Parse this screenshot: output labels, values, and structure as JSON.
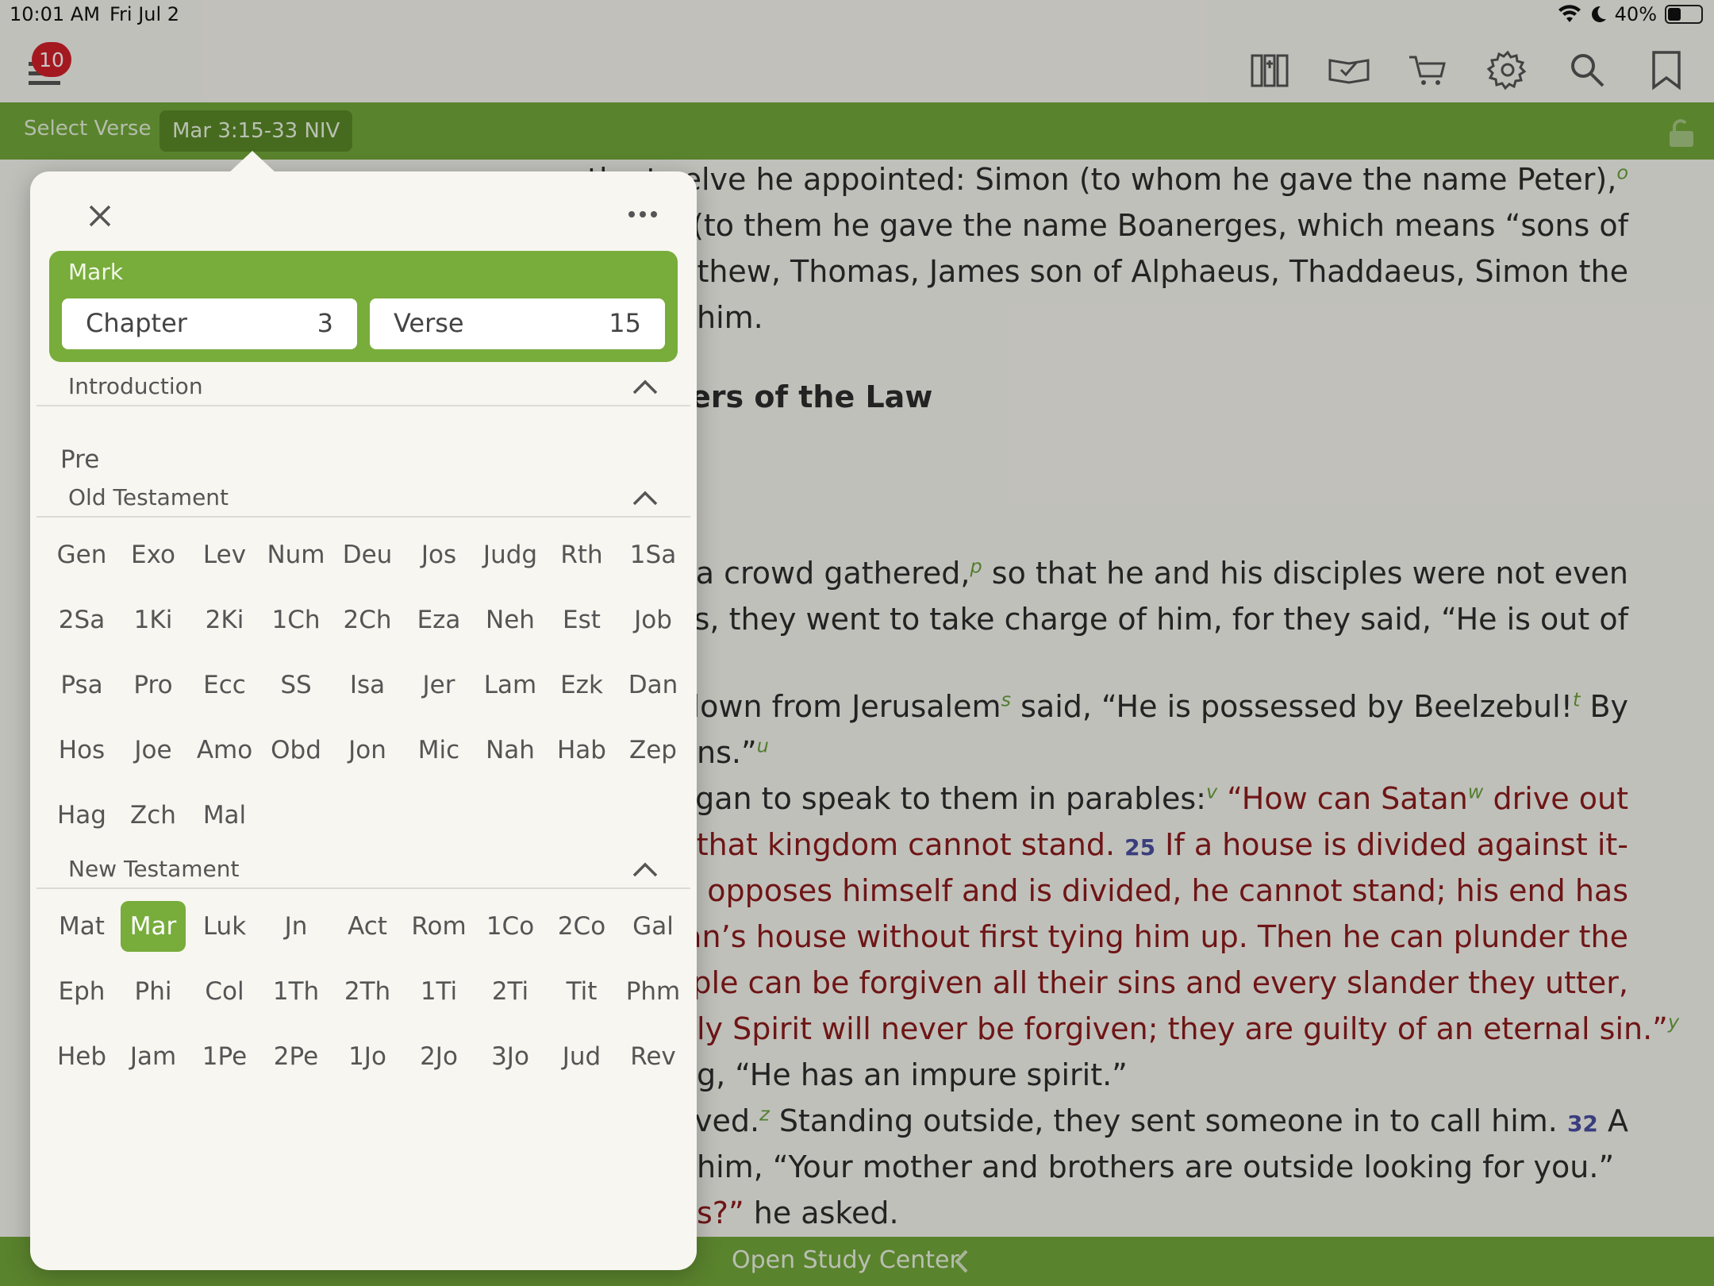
{
  "status": {
    "time": "10:01 AM",
    "date": "Fri Jul 2",
    "battery": "40%",
    "battery_level": 0.4
  },
  "toolbar": {
    "badge": "10"
  },
  "selectbar": {
    "label": "Select Verse",
    "reference": "Mar 3:15-33 NIV"
  },
  "reader": {
    "lines": [
      {
        "segments": [
          {
            "t": "the twelve he appointed: Simon (to whom he gave the name Peter),"
          },
          {
            "t": "o",
            "fn": true
          }
        ]
      },
      {
        "segments": [
          {
            "t": "John (to them he gave the name Boanerges, which means “sons of"
          }
        ]
      },
      {
        "segments": [
          {
            "t": ", Matthew, Thomas, James son of Alphaeus, Thaddaeus, Simon the"
          }
        ]
      },
      {
        "segments": [
          {
            "t": "him."
          }
        ],
        "left": true
      },
      {
        "segments": [
          {
            "t": "ers of the Law",
            "heading": true
          }
        ],
        "left": true
      },
      {
        "segments": [
          {
            "t": "ain a crowd gathered,"
          },
          {
            "t": "p",
            "fn": true
          },
          {
            "t": " so that he and his disciples were not even"
          }
        ]
      },
      {
        "segments": [
          {
            "t": "ut this, they went to take charge of him, for they said, “He is out of"
          }
        ]
      },
      {
        "segments": [
          {
            "t": "me down from Jerusalem"
          },
          {
            "t": "s",
            "fn": true
          },
          {
            "t": " said, “He is possessed by Beelzebul!"
          },
          {
            "t": "t",
            "fn": true
          },
          {
            "t": " By"
          }
        ]
      },
      {
        "segments": [
          {
            "t": "ns.”"
          },
          {
            "t": "u",
            "fn": true
          }
        ],
        "left": true
      },
      {
        "segments": [
          {
            "t": "d began to speak to them in parables:"
          },
          {
            "t": "v",
            "fn": true
          },
          {
            "t": " "
          },
          {
            "t": "“How can Satan",
            "red": true
          },
          {
            "t": "w",
            "fn": true
          },
          {
            "t": " drive out",
            "red": true
          }
        ]
      },
      {
        "segments": [
          {
            "t": "self, that kingdom cannot stand.  ",
            "red": true
          },
          {
            "t": "25",
            "vn": true
          },
          {
            "t": " If a house is divided against it-",
            "red": true
          }
        ]
      },
      {
        "segments": [
          {
            "t": "tan opposes himself and is divided, he cannot stand; his end has",
            "red": true
          }
        ]
      },
      {
        "segments": [
          {
            "t": "g man’s house without first tying him up. Then he can plunder the",
            "red": true
          }
        ]
      },
      {
        "segments": [
          {
            "t": "eople can be forgiven all their sins and every slander they utter,",
            "red": true
          }
        ]
      },
      {
        "segments": [
          {
            "t": "ly Spirit will never be forgiven; they are guilty of an eternal sin.”",
            "red": true
          },
          {
            "t": "y",
            "fn": true
          }
        ],
        "left": true
      },
      {
        "segments": [
          {
            "t": "g, “He has an impure spirit.”"
          }
        ],
        "left": true
      },
      {
        "segments": [
          {
            "t": "rrived."
          },
          {
            "t": "z",
            "fn": true
          },
          {
            "t": " Standing outside, they sent someone in to call him.  "
          },
          {
            "t": "32",
            "vn": true
          },
          {
            "t": " A"
          }
        ]
      },
      {
        "segments": [
          {
            "t": "him, “Your mother and brothers are outside looking for you.”"
          }
        ],
        "left": true
      },
      {
        "segments": [
          {
            "t": "s?”",
            "red": true
          },
          {
            "t": " he asked."
          }
        ],
        "left": true
      }
    ]
  },
  "bottombar": {
    "title": "Open Study Center"
  },
  "popover": {
    "book": "Mark",
    "chapter_label": "Chapter",
    "chapter_value": "3",
    "verse_label": "Verse",
    "verse_value": "15",
    "sections": {
      "intro": {
        "title": "Introduction",
        "items": [
          "Pre"
        ]
      },
      "ot": {
        "title": "Old Testament",
        "items": [
          "Gen",
          "Exo",
          "Lev",
          "Num",
          "Deu",
          "Jos",
          "Judg",
          "Rth",
          "1Sa",
          "2Sa",
          "1Ki",
          "2Ki",
          "1Ch",
          "2Ch",
          "Eza",
          "Neh",
          "Est",
          "Job",
          "Psa",
          "Pro",
          "Ecc",
          "SS",
          "Isa",
          "Jer",
          "Lam",
          "Ezk",
          "Dan",
          "Hos",
          "Joe",
          "Amo",
          "Obd",
          "Jon",
          "Mic",
          "Nah",
          "Hab",
          "Zep",
          "Hag",
          "Zch",
          "Mal"
        ]
      },
      "nt": {
        "title": "New Testament",
        "items": [
          "Mat",
          "Mar",
          "Luk",
          "Jn",
          "Act",
          "Rom",
          "1Co",
          "2Co",
          "Gal",
          "Eph",
          "Phi",
          "Col",
          "1Th",
          "2Th",
          "1Ti",
          "2Ti",
          "Tit",
          "Phm",
          "Heb",
          "Jam",
          "1Pe",
          "2Pe",
          "1Jo",
          "2Jo",
          "3Jo",
          "Jud",
          "Rev"
        ],
        "selected": "Mar"
      }
    }
  },
  "colors": {
    "accent": "#74a83a",
    "badge": "#d3202a",
    "words_of_christ": "#8e1b1b",
    "footnote": "#6aa23c",
    "verse_number": "#4b4fa0"
  }
}
